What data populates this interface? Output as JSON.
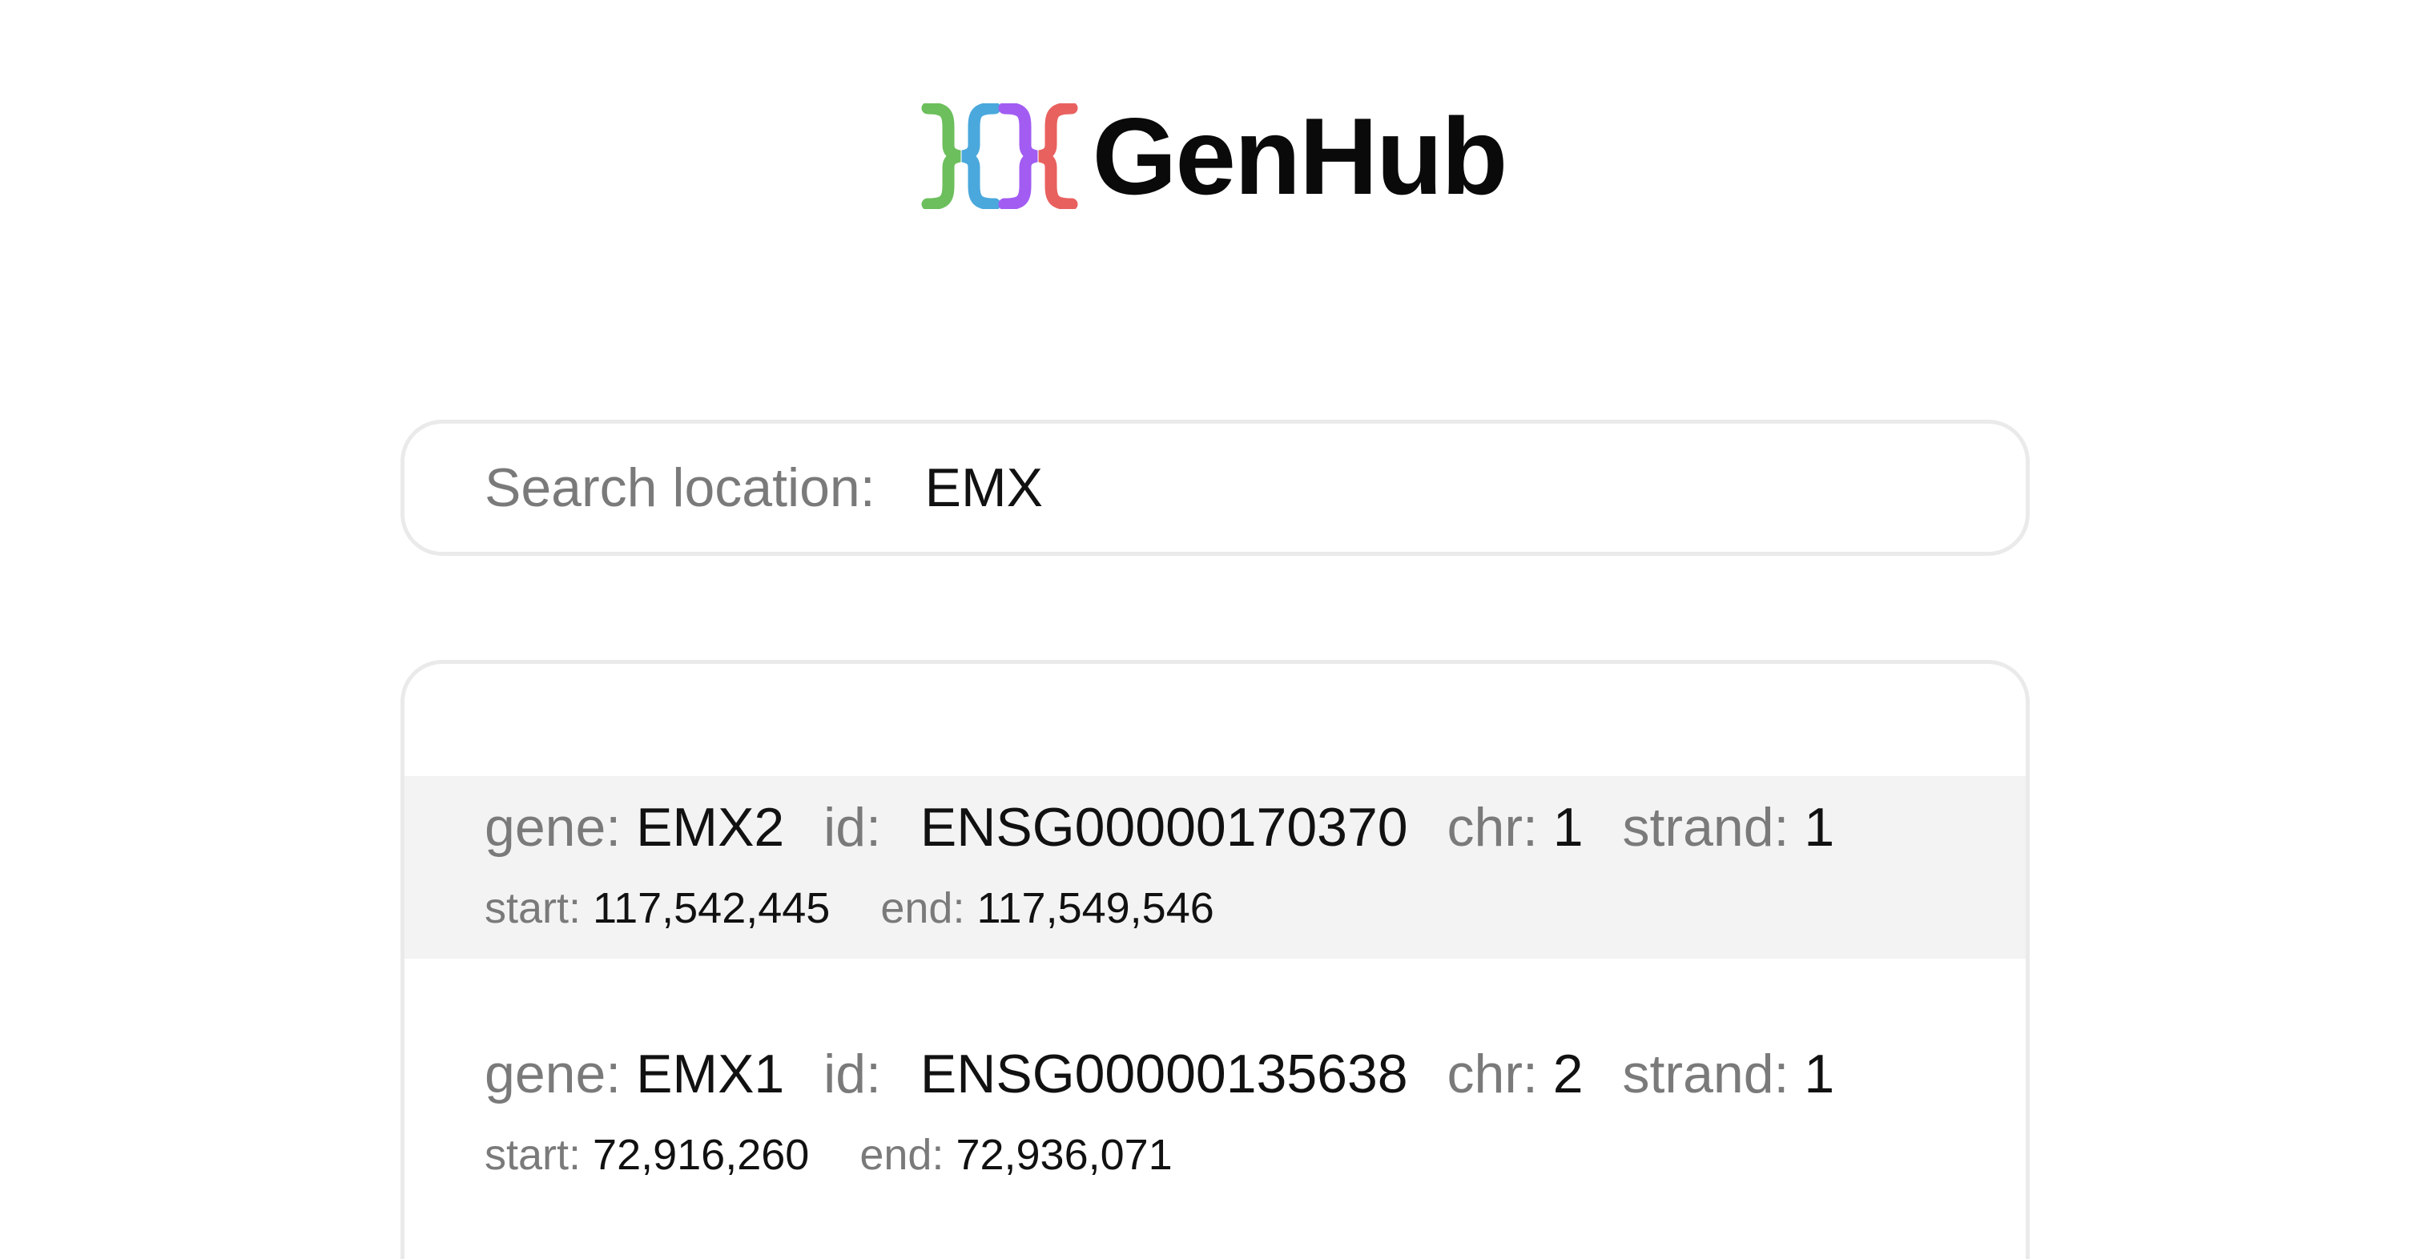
{
  "brand": {
    "name": "GenHub",
    "logo_colors": [
      "#6cbf5c",
      "#4aa8dc",
      "#a25cf2",
      "#e8615f"
    ]
  },
  "search": {
    "label": "Search location:",
    "value": "EMX"
  },
  "results": [
    {
      "gene_label": "gene:",
      "gene": "EMX2",
      "id_label": "id:",
      "id": "ENSG00000170370",
      "chr_label": "chr:",
      "chr": "1",
      "strand_label": "strand:",
      "strand": "1",
      "start_label": "start:",
      "start": "117,542,445",
      "end_label": "end:",
      "end": "117,549,546"
    },
    {
      "gene_label": "gene:",
      "gene": "EMX1",
      "id_label": "id:",
      "id": "ENSG00000135638",
      "chr_label": "chr:",
      "chr": "2",
      "strand_label": "strand:",
      "strand": "1",
      "start_label": "start:",
      "start": "72,916,260",
      "end_label": "end:",
      "end": "72,936,071"
    }
  ]
}
